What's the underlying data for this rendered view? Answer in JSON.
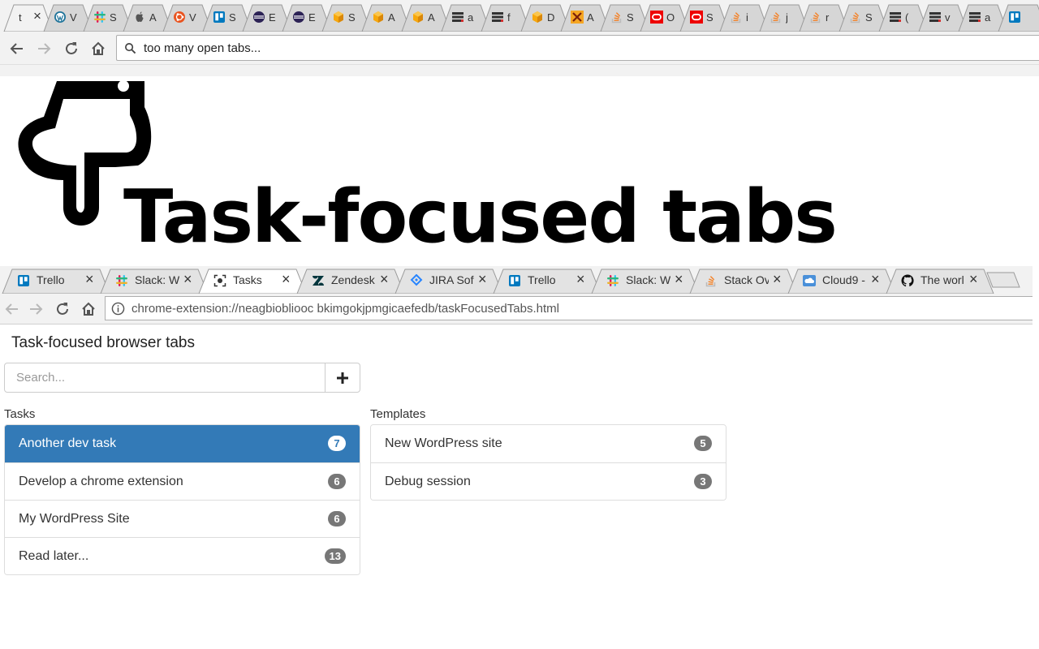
{
  "colors": {
    "accent": "#337ab7",
    "badge": "#777777",
    "tab_active": "#f2f2f2",
    "tab_inactive": "#d6d6d6"
  },
  "top_browser": {
    "tabs": [
      {
        "icon": "text-tab-icon",
        "label": "t",
        "active": true
      },
      {
        "icon": "wordpress-icon",
        "label": "V"
      },
      {
        "icon": "slack-icon",
        "label": "S"
      },
      {
        "icon": "apple-icon",
        "label": "A"
      },
      {
        "icon": "ubuntu-icon",
        "label": "V"
      },
      {
        "icon": "trello-icon",
        "label": "S"
      },
      {
        "icon": "eclipse-icon",
        "label": "E"
      },
      {
        "icon": "eclipse-icon",
        "label": "E"
      },
      {
        "icon": "aws-cube-icon",
        "label": "S"
      },
      {
        "icon": "aws-cube-icon",
        "label": "A"
      },
      {
        "icon": "aws-cube-icon",
        "label": "A"
      },
      {
        "icon": "bars-icon",
        "label": "a"
      },
      {
        "icon": "bars-icon",
        "label": "f"
      },
      {
        "icon": "aws-cube-icon",
        "label": "D"
      },
      {
        "icon": "xk-icon",
        "label": "A"
      },
      {
        "icon": "stackoverflow-icon",
        "label": "S"
      },
      {
        "icon": "oracle-icon",
        "label": "O"
      },
      {
        "icon": "oracle-icon",
        "label": "S"
      },
      {
        "icon": "stackoverflow-icon",
        "label": "i"
      },
      {
        "icon": "stackoverflow-icon",
        "label": "j"
      },
      {
        "icon": "stackoverflow-icon",
        "label": "r"
      },
      {
        "icon": "stackoverflow-icon",
        "label": "S"
      },
      {
        "icon": "bars-icon",
        "label": "("
      },
      {
        "icon": "bars-icon",
        "label": "v"
      },
      {
        "icon": "bars-icon",
        "label": "a"
      },
      {
        "icon": "trello-icon",
        "label": ""
      }
    ],
    "omnibox_text": "too many open tabs..."
  },
  "hero": {
    "title": "Task-focused tabs"
  },
  "inner_browser": {
    "tabs": [
      {
        "icon": "trello-icon",
        "label": "Trello"
      },
      {
        "icon": "slack-icon",
        "label": "Slack: W"
      },
      {
        "icon": "tasks-icon",
        "label": "Tasks",
        "active": true
      },
      {
        "icon": "zendesk-icon",
        "label": "Zendesk"
      },
      {
        "icon": "jira-icon",
        "label": "JIRA Soft"
      },
      {
        "icon": "trello-icon",
        "label": "Trello"
      },
      {
        "icon": "slack-icon",
        "label": "Slack: W"
      },
      {
        "icon": "stackoverflow-icon",
        "label": "Stack Ov"
      },
      {
        "icon": "cloud9-icon",
        "label": "Cloud9 -"
      },
      {
        "icon": "github-icon",
        "label": "The worl"
      }
    ],
    "address": "chrome-extension://neagbiobliooc bkimgokjpmgicaefedb/taskFocusedTabs.html"
  },
  "page": {
    "heading": "Task-focused browser tabs",
    "search_placeholder": "Search...",
    "add_label": "+",
    "tasks_label": "Tasks",
    "templates_label": "Templates",
    "tasks": [
      {
        "name": "Another dev task",
        "count": "7",
        "active": true
      },
      {
        "name": "Develop a chrome extension",
        "count": "6"
      },
      {
        "name": "My WordPress Site",
        "count": "6"
      },
      {
        "name": "Read later...",
        "count": "13"
      }
    ],
    "templates": [
      {
        "name": "New WordPress site",
        "count": "5"
      },
      {
        "name": "Debug session",
        "count": "3"
      }
    ]
  }
}
